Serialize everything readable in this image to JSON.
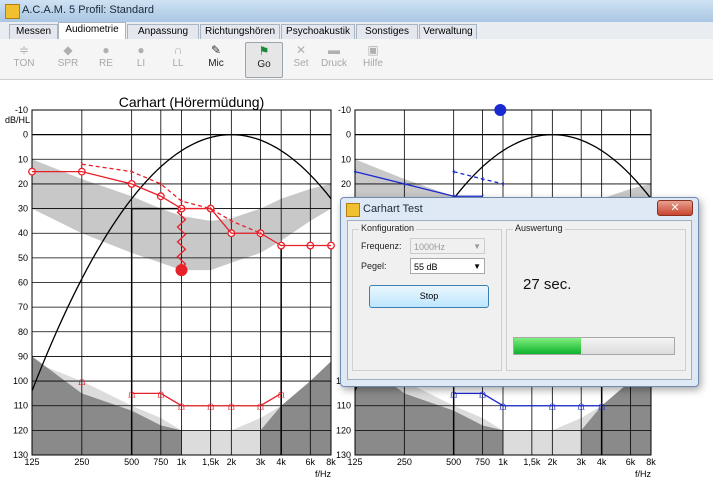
{
  "window": {
    "title": "A.C.A.M. 5  Profil: Standard"
  },
  "tabs": [
    "Messen",
    "Audiometrie",
    "Anpassung",
    "Richtungshören",
    "Psychoakustik",
    "Sonstiges",
    "Verwaltung"
  ],
  "toolbar": {
    "items": [
      {
        "label": "TON",
        "icon": "equalizer-icon"
      },
      {
        "label": "SPR",
        "icon": "speech-icon"
      },
      {
        "label": "RE",
        "icon": "right-ear-icon"
      },
      {
        "label": "LI",
        "icon": "left-ear-icon"
      },
      {
        "label": "LL",
        "icon": "headphones-icon"
      },
      {
        "label": "Mic",
        "icon": "microphone-icon"
      },
      {
        "label": "Go",
        "icon": "run-icon"
      },
      {
        "label": "Set",
        "icon": "tools-icon"
      },
      {
        "label": "Druck",
        "icon": "printer-icon"
      },
      {
        "label": "Hilfe",
        "icon": "help-icon"
      }
    ]
  },
  "chart_data": [
    {
      "type": "line",
      "title": "Carhart (Hörermüdung)",
      "ylabel": "dB/HL",
      "xlabel": "f/Hz",
      "ylim": [
        -10,
        130
      ],
      "y_ticks": [
        "-10",
        "0",
        "10",
        "20",
        "30",
        "40",
        "50",
        "60",
        "70",
        "80",
        "90",
        "100",
        "110",
        "120",
        "130"
      ],
      "x_ticks": [
        "125",
        "250",
        "500",
        "750",
        "1k",
        "1,5k",
        "2k",
        "3k",
        "4k",
        "6k",
        "8k"
      ],
      "series": [
        {
          "values": [
            15,
            15,
            20,
            25,
            30,
            30,
            40,
            40,
            45,
            45,
            45
          ],
          "color": "#e8202a"
        },
        {
          "values": [
            null,
            12,
            15,
            20,
            27,
            30,
            35,
            40,
            null,
            null,
            null
          ],
          "color": "#e8202a"
        },
        {
          "values": [
            null,
            100,
            null,
            null,
            null,
            null,
            null,
            null,
            null,
            null,
            null
          ],
          "color": "#e8202a"
        },
        {
          "values": [
            null,
            null,
            105,
            105,
            110,
            110,
            110,
            110,
            105,
            null,
            null
          ],
          "color": "#e8202a"
        }
      ],
      "test_point": {
        "x": "1k",
        "y": 55,
        "color": "#e8202a"
      }
    },
    {
      "type": "line",
      "xlabel": "f/Hz",
      "ylim": [
        -10,
        130
      ],
      "y_ticks": [
        "-10",
        "0",
        "10",
        "20",
        "30",
        "40",
        "50",
        "60",
        "70",
        "80",
        "90",
        "100",
        "110",
        "120",
        "130"
      ],
      "x_ticks": [
        "125",
        "250",
        "500",
        "750",
        "1k",
        "1,5k",
        "2k",
        "3k",
        "4k",
        "6k",
        "8k"
      ],
      "series": [
        {
          "values": [
            15,
            20,
            25,
            25,
            null,
            null,
            null,
            null,
            null,
            null,
            null
          ],
          "color": "#1a2ad0"
        },
        {
          "values": [
            null,
            null,
            15,
            18,
            20,
            null,
            null,
            null,
            null,
            null,
            null
          ],
          "color": "#1a2ad0"
        },
        {
          "values": [
            null,
            null,
            105,
            105,
            110,
            null,
            110,
            110,
            110,
            null,
            null
          ],
          "color": "#1a2ad0"
        }
      ],
      "marker": {
        "y": -10,
        "color": "#1a2ad0"
      }
    }
  ],
  "dialog": {
    "title": "Carhart Test",
    "close": "✕",
    "config_label": "Konfiguration",
    "freq_label": "Frequenz:",
    "freq_value": "1000Hz",
    "level_label": "Pegel:",
    "level_value": "55 dB",
    "stop": "Stop",
    "result_label": "Auswertung",
    "timer": "27 sec.",
    "progress": 0.42
  }
}
